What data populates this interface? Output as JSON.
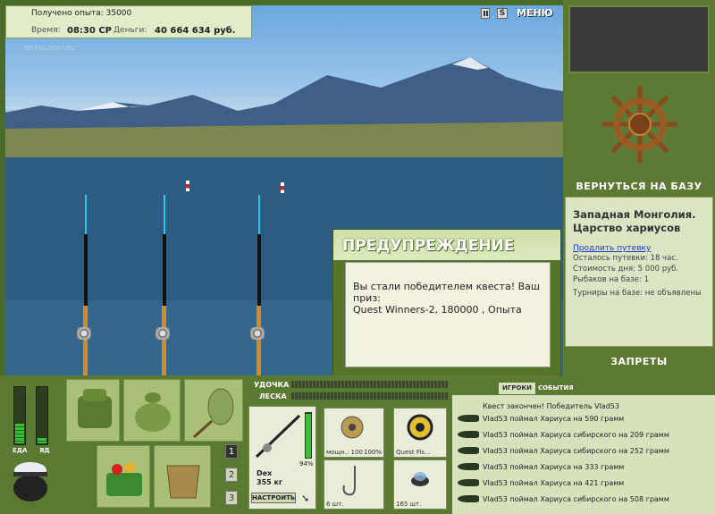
{
  "hud": {
    "exp_label": "Получено опыта:",
    "exp_value": "35000",
    "time_label": "Время:",
    "time_value": "08:30 СР",
    "money_label": "Деньги:",
    "money_value": "40 664 634 руб.",
    "menu_label": "МЕНЮ",
    "watermark": "INSTALLSOFT.RU"
  },
  "warning": {
    "title": "ПРЕДУПРЕЖДЕНИЕ",
    "line1": "Вы стали победителем квеста! Ваш приз:",
    "line2": "Quest Winners-2, 180000 , Опыта"
  },
  "right_panel": {
    "return_label": "ВЕРНУТЬСЯ НА БАЗУ",
    "location_title_1": "Западная Монголия.",
    "location_title_2": "Царство хариусов",
    "extend_link": "Продлить путевку",
    "remaining": "Осталось путевки: 18 час.",
    "cost": "Стоимость дня: 5 000 руб.",
    "fishers": "Рыбаков на базе: 1",
    "tournaments": "Турниры на базе: не объявлены",
    "bans_label": "ЗАПРЕТЫ"
  },
  "stats": {
    "food_label": "ЕДА",
    "poison_label": "ЯД",
    "food_level": 0.35,
    "poison_level": 0.1
  },
  "tackle": {
    "rod_label": "УДОЧКА",
    "line_label": "ЛЕСКА",
    "rod_name": "Dex",
    "rod_load": "355 кг",
    "rod_percent": "94%",
    "setup_label": "НАСТРОИТЬ",
    "reel_caption": "мощн.: 100",
    "reel_percent": "100%",
    "line_caption": "Quest Fis...",
    "hook_caption": "6 шт.",
    "bait_caption": "165 шт."
  },
  "pages": [
    "1",
    "2",
    "3"
  ],
  "log": {
    "tab_players": "ИГРОКИ",
    "tab_events": "СОБЫТИЯ",
    "header": "Квест закончен! Победитель Vlad53",
    "entries": [
      "Vlad53 поймал Хариуса на 590 грамм",
      "Vlad53 поймал Хариуса сибирского на 209 грамм",
      "Vlad53 поймал Хариуса сибирского на 252 грамм",
      "Vlad53 поймал Хариуса на 333 грамм",
      "Vlad53 поймал Хариуса на 421 грамм",
      "Vlad53 поймал Хариуса сибирского на 508 грамм"
    ]
  },
  "colors": {
    "panel_green": "#5a7a32",
    "float_red": "#d2221e",
    "link_blue": "#1a3ad0"
  }
}
